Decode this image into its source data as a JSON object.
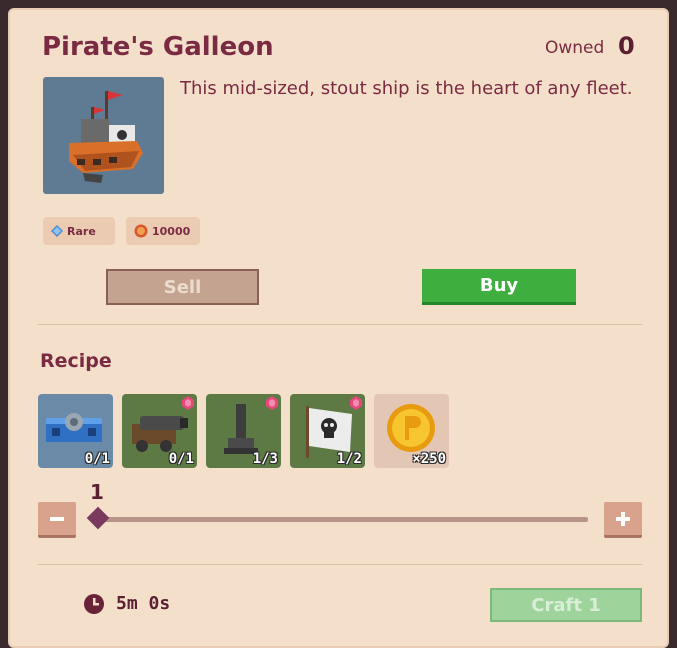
{
  "item": {
    "title": "Pirate's Galleon",
    "owned_label": "Owned",
    "owned_value": "0",
    "description": "This mid-sized, stout ship is the heart of any fleet.",
    "rarity": "Rare",
    "price": "10000"
  },
  "actions": {
    "sell_label": "Sell",
    "buy_label": "Buy"
  },
  "recipe": {
    "title": "Recipe",
    "ingredients": [
      {
        "icon": "blue-component-icon",
        "count": "0/1"
      },
      {
        "icon": "cannon-icon",
        "count": "0/1"
      },
      {
        "icon": "mast-icon",
        "count": "1/3"
      },
      {
        "icon": "skull-flag-icon",
        "count": "1/2"
      },
      {
        "icon": "gold-coin-icon",
        "count": "×250"
      }
    ],
    "quantity": "1",
    "quantity_fraction": 0,
    "time": "5m 0s",
    "craft_label": "Craft 1"
  },
  "colors": {
    "panel_bg": "#f4dfcb",
    "title": "#7a2b43",
    "buy_green": "#3eaf3e",
    "craft_disabled": "#9fd39c",
    "gem_pink": "#e8477c"
  }
}
